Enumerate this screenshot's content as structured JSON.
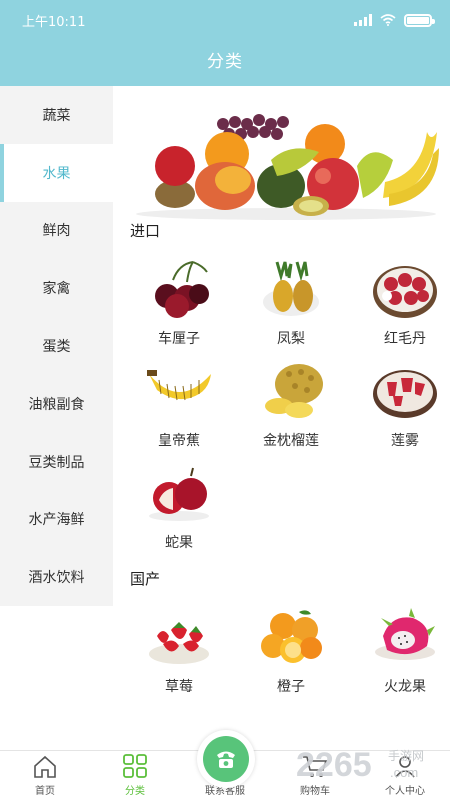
{
  "status_bar": {
    "time": "上午10:11"
  },
  "header": {
    "title": "分类"
  },
  "sidebar": {
    "items": [
      {
        "label": "蔬菜"
      },
      {
        "label": "水果"
      },
      {
        "label": "鲜肉"
      },
      {
        "label": "家禽"
      },
      {
        "label": "蛋类"
      },
      {
        "label": "油粮副食"
      },
      {
        "label": "豆类制品"
      },
      {
        "label": "水产海鲜"
      },
      {
        "label": "酒水饮料"
      }
    ],
    "active_index": 1
  },
  "sections": [
    {
      "title": "进口",
      "items": [
        {
          "label": "车厘子",
          "icon": "cherry-icon"
        },
        {
          "label": "凤梨",
          "icon": "pineapple-icon"
        },
        {
          "label": "红毛丹",
          "icon": "rambutan-icon"
        },
        {
          "label": "皇帝蕉",
          "icon": "banana-icon"
        },
        {
          "label": "金枕榴莲",
          "icon": "durian-icon"
        },
        {
          "label": "莲雾",
          "icon": "wax-apple-icon"
        },
        {
          "label": "蛇果",
          "icon": "apple-icon"
        }
      ]
    },
    {
      "title": "国产",
      "items": [
        {
          "label": "草莓",
          "icon": "strawberry-icon"
        },
        {
          "label": "橙子",
          "icon": "orange-icon"
        },
        {
          "label": "火龙果",
          "icon": "dragon-fruit-icon"
        }
      ]
    }
  ],
  "bottom_nav": {
    "items": [
      {
        "label": "首页",
        "icon": "home-icon"
      },
      {
        "label": "分类",
        "icon": "category-grid-icon"
      },
      {
        "label": "联系客服",
        "icon": "phone-icon"
      },
      {
        "label": "购物车",
        "icon": "cart-icon"
      },
      {
        "label": "个人中心",
        "icon": "user-icon"
      }
    ],
    "active_index": 1
  },
  "watermark": {
    "text": "2265",
    "sub": "手游网",
    "domain": ".com"
  },
  "colors": {
    "header": "#8fd3df",
    "active_text": "#52b8cc",
    "nav_active": "#5bbf3a",
    "service": "#58c47a"
  }
}
